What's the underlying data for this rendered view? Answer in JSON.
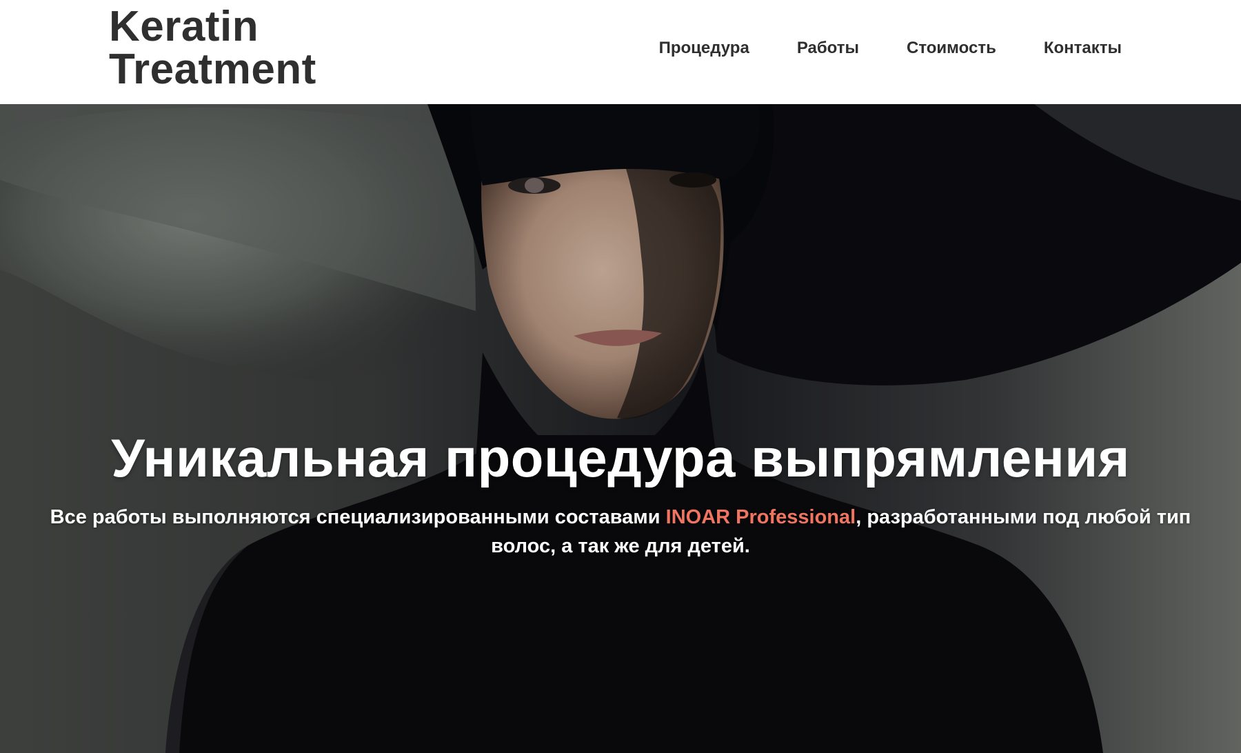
{
  "header": {
    "logo_line1": "Keratin",
    "logo_line2": "Treatment",
    "nav": [
      {
        "label": "Процедура"
      },
      {
        "label": "Работы"
      },
      {
        "label": "Стоимость"
      },
      {
        "label": "Контакты"
      }
    ]
  },
  "hero": {
    "title": "Уникальная процедура выпрямления",
    "subtitle_before": "Все работы выполняются специализированными составами ",
    "subtitle_brand": "INOAR Professional",
    "subtitle_after": ", разработанными под любой тип волос, а так же для детей.",
    "image_icon": "woman-portrait-photo"
  },
  "colors": {
    "header_bg": "#ffffff",
    "text_dark": "#2f2f2f",
    "hero_text": "#ffffff",
    "brand_accent": "#f07560"
  }
}
